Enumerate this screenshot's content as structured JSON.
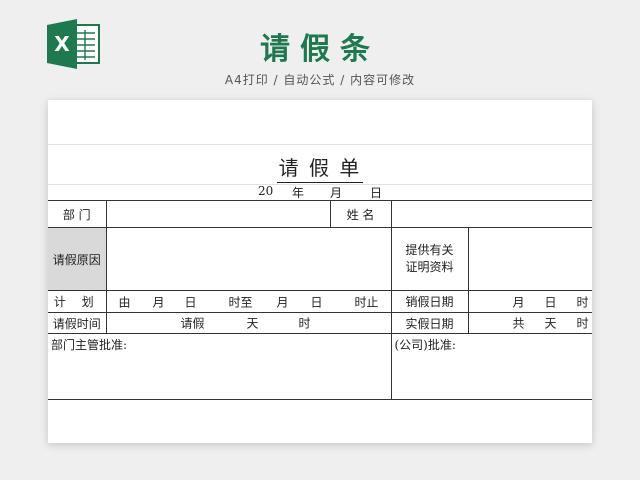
{
  "header": {
    "title": "请假条",
    "subtitle": "A4打印 / 自动公式 / 内容可修改",
    "logo_icon": "excel-icon",
    "logo_letter": "X",
    "logo_color": "#1e7a4e"
  },
  "form": {
    "title": "请 假 单",
    "date": {
      "year_prefix": "20",
      "year": "年",
      "month": "月",
      "day": "日"
    },
    "department_label": "部 门",
    "name_label": "姓 名",
    "reason_label": "请假原因",
    "proof_label_line1": "提供有关",
    "proof_label_line2": "证明资料",
    "plan_label": "计 划",
    "plan_time_label": "请假时间",
    "plan_from": "由",
    "plan_month": "月",
    "plan_day": "日",
    "plan_until": "时至",
    "plan_month2": "月",
    "plan_day2": "日",
    "plan_stop": "时止",
    "plan_leave": "请假",
    "plan_days": "天",
    "plan_hours": "时",
    "cancel_label": "销假日期",
    "cancel_month": "月",
    "cancel_day": "日",
    "cancel_hour": "时",
    "actual_label": "实假日期",
    "actual_total": "共",
    "actual_days": "天",
    "actual_hours": "时",
    "dept_head_approval": "部门主管批准:",
    "company_approval": "(公司)批准:"
  },
  "colors": {
    "title_green": "#1e7a4e",
    "grey_cell": "#d9d9d9"
  }
}
